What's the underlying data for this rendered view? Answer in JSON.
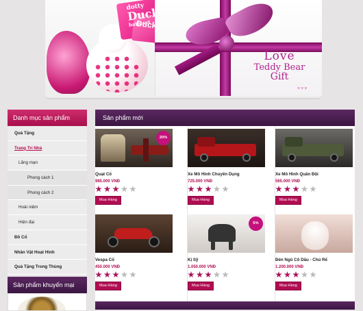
{
  "banner": {
    "product_brand": "dotty",
    "product_name": "Ducky",
    "product_sub": "bath set",
    "card2_name": "Ducky",
    "gift_title": [
      "Love",
      "Teddy Bear",
      "Gift"
    ],
    "hearts": "♥♥♥"
  },
  "sidebar": {
    "title": "Danh mục sản phẩm",
    "items": [
      {
        "label": "Quà Tặng",
        "level": 0,
        "active": false
      },
      {
        "label": "Trang Trí Nhà",
        "level": 0,
        "active": true
      },
      {
        "label": "Lãng mạn",
        "level": 1,
        "active": false
      },
      {
        "label": "Phong cách 1",
        "level": 2,
        "active": false
      },
      {
        "label": "Phong cách 2",
        "level": 2,
        "active": false
      },
      {
        "label": "Hoài niệm",
        "level": 1,
        "active": false
      },
      {
        "label": "Hiện đại",
        "level": 1,
        "active": false
      },
      {
        "label": "Đồ Cổ",
        "level": 0,
        "active": false
      },
      {
        "label": "Nhân Vật Hoạt Hình",
        "level": 0,
        "active": false
      },
      {
        "label": "Quà Tặng Trong Thùng",
        "level": 0,
        "active": false
      }
    ],
    "promo_title": "Sản phẩm khuyến mại"
  },
  "main": {
    "title": "Sản phẩm mới",
    "buy_label": "Mua Hàng",
    "products": [
      {
        "name": "Quạt Cổ",
        "price": "985.000 VNĐ",
        "rating": 3,
        "badge": "20%",
        "art": "plane"
      },
      {
        "name": "Xe Mô Hình Chuyên Dụng",
        "price": "725.000 VNĐ",
        "rating": 3,
        "badge": "",
        "art": "red-truck"
      },
      {
        "name": "Xe Mô Hình Quân Đội",
        "price": "565.000 VNĐ",
        "rating": 3,
        "badge": "",
        "art": "army-truck"
      },
      {
        "name": "Vespa Cổ",
        "price": "450.000 VNĐ",
        "rating": 3,
        "badge": "",
        "art": "moto"
      },
      {
        "name": "Kị Sỹ",
        "price": "1.050.000 VNĐ",
        "rating": 3,
        "badge": "5%",
        "art": "horse"
      },
      {
        "name": "Đèn Ngủ Cô Dâu - Chú Rể",
        "price": "1.200.000 VNĐ",
        "rating": 3,
        "badge": "",
        "art": "bride"
      }
    ]
  },
  "colors": {
    "accent": "#b10d52",
    "header_purple": "#4a1e52",
    "sidebar_pink": "#c01f5f",
    "badge": "#c4117b"
  }
}
